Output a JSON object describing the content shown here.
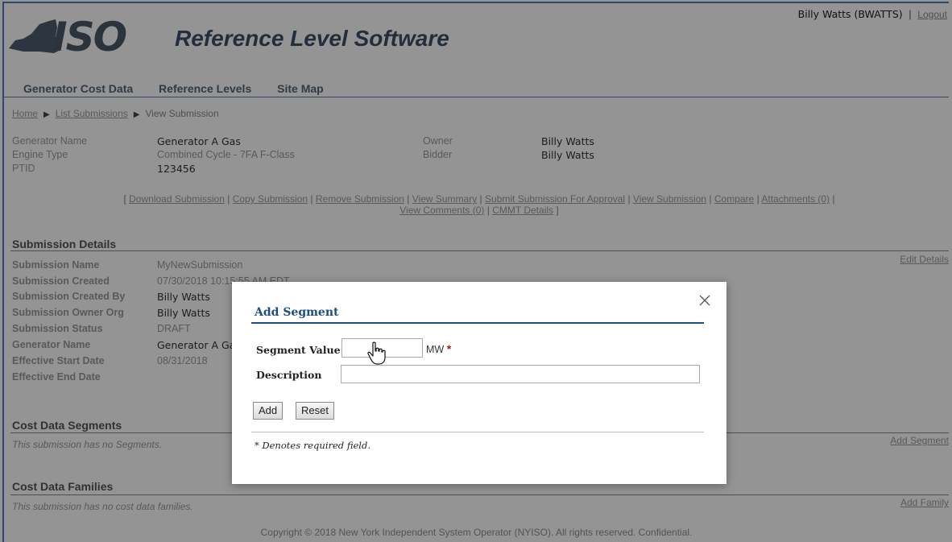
{
  "app": {
    "logo_text": "ISO",
    "title": "Reference Level Software"
  },
  "user": {
    "name": "Billy Watts (BWATTS)",
    "separator": "|",
    "logout": "Logout"
  },
  "nav": {
    "items": [
      "Generator Cost Data",
      "Reference Levels",
      "Site Map"
    ]
  },
  "breadcrumb": {
    "home": "Home",
    "list": "List Submissions",
    "current": "View Submission"
  },
  "generator": {
    "name_label": "Generator Name",
    "name_value": "Generator A Gas",
    "engine_label": "Engine Type",
    "engine_value": "Combined Cycle - 7FA F-Class",
    "ptid_label": "PTID",
    "ptid_value": "123456",
    "owner_label": "Owner",
    "owner_value": "Billy Watts",
    "bidder_label": "Bidder",
    "bidder_value": "Billy Watts"
  },
  "actions": {
    "open": "[",
    "close": "]",
    "sep": "|",
    "links": [
      "Download Submission",
      "Copy Submission",
      "Remove Submission",
      "View Summary",
      "Submit Submission For Approval",
      "View Submission",
      "Compare",
      "Attachments (0)",
      "View Comments (0)",
      "CMMT Details"
    ]
  },
  "submission_details": {
    "title": "Submission Details",
    "edit_link": "Edit Details",
    "rows": [
      {
        "label": "Submission Name",
        "value": "MyNewSubmission"
      },
      {
        "label": "Submission Created",
        "value": "07/30/2018 10:15:55 AM EDT"
      },
      {
        "label": "Submission Created By",
        "value": "Billy Watts"
      },
      {
        "label": "Submission Owner Org",
        "value": "Billy Watts"
      },
      {
        "label": "Submission Status",
        "value": "DRAFT"
      },
      {
        "label": "Generator Name",
        "value": "Generator A Gas"
      },
      {
        "label": "Effective Start Date",
        "value": "08/31/2018"
      },
      {
        "label": "Effective End Date",
        "value": ""
      }
    ]
  },
  "cost_data_segments": {
    "title": "Cost Data Segments",
    "empty": "This submission has no Segments.",
    "add_link": "Add Segment"
  },
  "cost_data_families": {
    "title": "Cost Data Families",
    "empty": "This submission has no cost data families.",
    "add_link": "Add Family"
  },
  "footer": "Copyright © 2018 New York Independent System Operator (NYISO). All rights reserved. Confidential.",
  "modal": {
    "title": "Add Segment",
    "segment_value_label": "Segment Value",
    "segment_value": "",
    "unit": "MW",
    "required_mark": "*",
    "description_label": "Description",
    "description_value": "",
    "add_button": "Add",
    "reset_button": "Reset",
    "note": "* Denotes required field."
  },
  "colors": {
    "accent": "#1f4e7a",
    "nav_line": "#5f7ea3",
    "required": "#9b1b1b"
  }
}
